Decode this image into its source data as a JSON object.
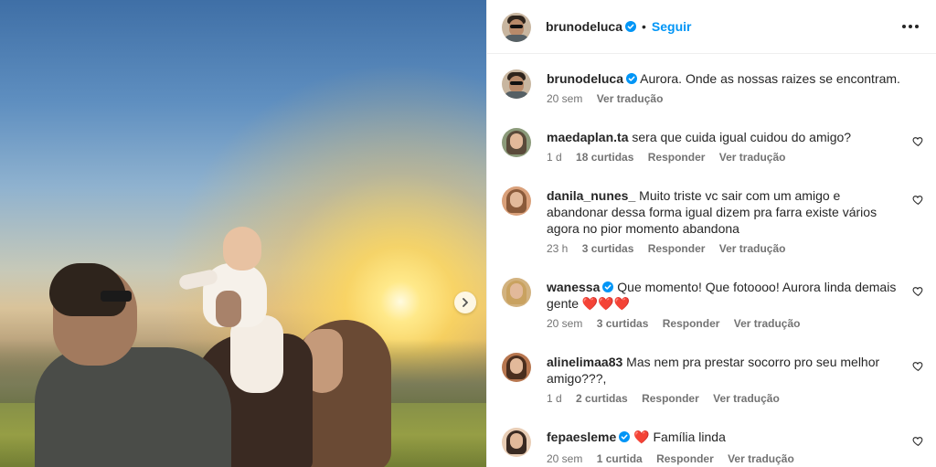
{
  "post": {
    "author": "brunodeluca",
    "follow_label": "Seguir",
    "separator": "•",
    "caption": {
      "username": "brunodeluca",
      "text": "Aurora. Onde as nossas raizes se encontram.",
      "time": "20 sem",
      "translate": "Ver tradução"
    }
  },
  "comments": [
    {
      "username": "maedaplan.ta",
      "verified": false,
      "text": "sera que cuida igual cuidou do amigo?",
      "time": "1 d",
      "likes": "18 curtidas",
      "reply": "Responder",
      "translate": "Ver tradução"
    },
    {
      "username": "danila_nunes_",
      "verified": false,
      "text": "Muito triste vc sair com um amigo e abandonar dessa forma igual dizem pra farra existe vários agora no pior momento abandona",
      "time": "23 h",
      "likes": "3 curtidas",
      "reply": "Responder",
      "translate": "Ver tradução"
    },
    {
      "username": "wanessa",
      "verified": true,
      "text": "Que momento! Que fotoooo! Aurora linda demais gente ❤️❤️❤️",
      "time": "20 sem",
      "likes": "3 curtidas",
      "reply": "Responder",
      "translate": "Ver tradução"
    },
    {
      "username": "alinelimaa83",
      "verified": false,
      "text": "Mas nem pra prestar socorro pro seu melhor amigo???,",
      "time": "1 d",
      "likes": "2 curtidas",
      "reply": "Responder",
      "translate": "Ver tradução"
    },
    {
      "username": "fepaesleme",
      "verified": true,
      "text": "❤️ Família linda",
      "time": "20 sem",
      "likes": "1 curtida",
      "reply": "Responder",
      "translate": "Ver tradução"
    }
  ],
  "colors": {
    "accent": "#0095f6",
    "text": "#262626",
    "secondary": "#737373",
    "divider": "#efefef"
  }
}
